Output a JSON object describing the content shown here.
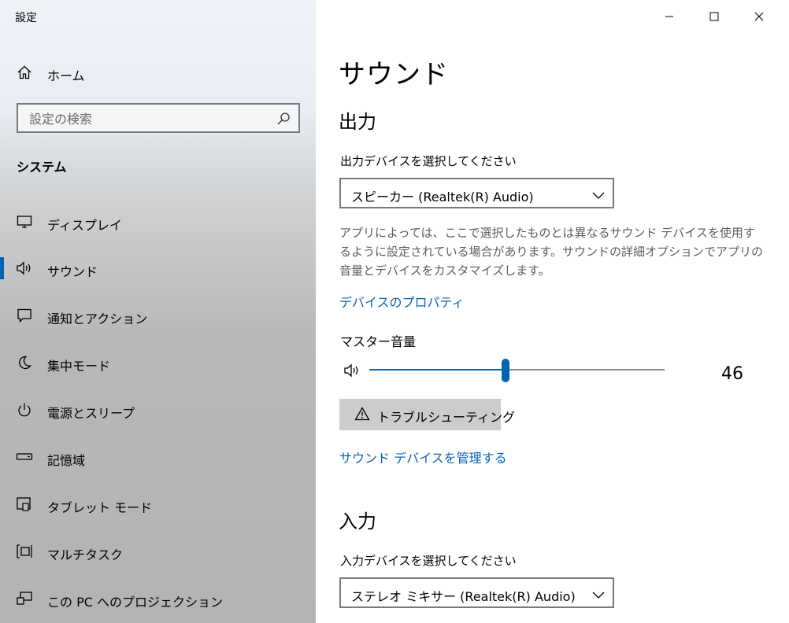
{
  "window": {
    "title": "設定",
    "controls": {
      "minimize": "minimize-icon",
      "maximize": "maximize-icon",
      "close": "close-icon"
    }
  },
  "sidebar": {
    "home_label": "ホーム",
    "search_placeholder": "設定の検索",
    "section_title": "システム",
    "items": [
      {
        "label": "ディスプレイ",
        "icon": "display-icon"
      },
      {
        "label": "サウンド",
        "icon": "sound-icon",
        "selected": true
      },
      {
        "label": "通知とアクション",
        "icon": "notification-icon"
      },
      {
        "label": "集中モード",
        "icon": "moon-icon"
      },
      {
        "label": "電源とスリープ",
        "icon": "power-icon"
      },
      {
        "label": "記憶域",
        "icon": "storage-icon"
      },
      {
        "label": "タブレット モード",
        "icon": "tablet-icon"
      },
      {
        "label": "マルチタスク",
        "icon": "multitask-icon"
      },
      {
        "label": "この PC へのプロジェクション",
        "icon": "projection-icon"
      }
    ],
    "accent_color": "#0063b1"
  },
  "main": {
    "title": "サウンド",
    "output": {
      "heading": "出力",
      "device_label": "出力デバイスを選択してください",
      "device_value": "スピーカー (Realtek(R) Audio)",
      "description": "アプリによっては、ここで選択したものとは異なるサウンド デバイスを使用するように設定されている場合があります。サウンドの詳細オプションでアプリの音量とデバイスをカスタマイズします。",
      "device_properties_link": "デバイスのプロパティ",
      "master_volume_label": "マスター音量",
      "master_volume": 46,
      "troubleshoot_label": "トラブルシューティング",
      "manage_devices_link": "サウンド デバイスを管理する"
    },
    "input": {
      "heading": "入力",
      "device_label": "入力デバイスを選択してください",
      "device_value": "ステレオ ミキサー (Realtek(R) Audio)"
    },
    "link_color": "#0b63b5"
  }
}
